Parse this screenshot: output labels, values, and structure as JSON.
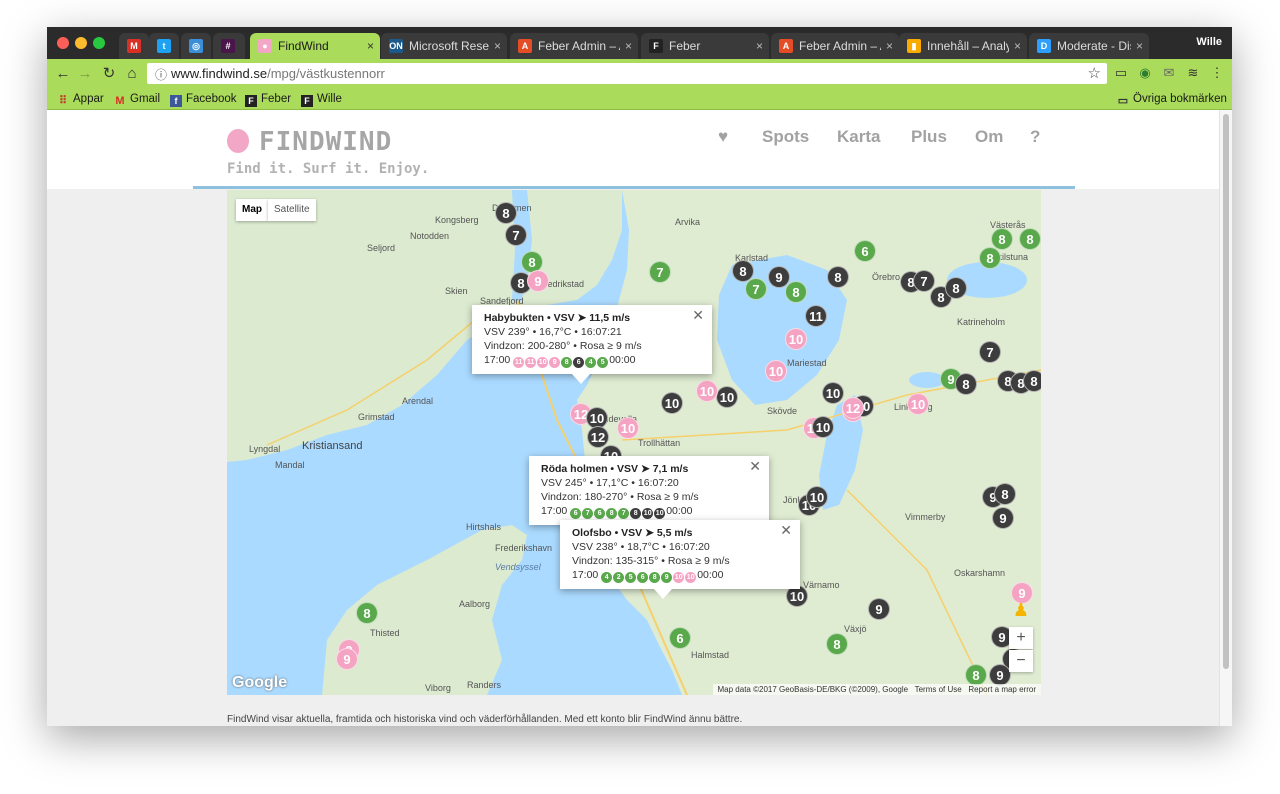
{
  "browser": {
    "profile": "Wille",
    "tabs": [
      {
        "title": "",
        "favicon": "M",
        "favicon_color": "#d93025",
        "name": "tab-gmail"
      },
      {
        "title": "",
        "favicon": "t",
        "favicon_color": "#1da1f2",
        "name": "tab-twitter"
      },
      {
        "title": "",
        "favicon": "◎",
        "favicon_color": "#3b8fd9",
        "name": "tab-rss"
      },
      {
        "title": "",
        "favicon": "#",
        "favicon_color": "#4a154b",
        "name": "tab-slack"
      },
      {
        "title": "FindWind",
        "favicon": "●",
        "favicon_color": "#f3a7c6",
        "name": "tab-findwind"
      },
      {
        "title": "Microsoft Research",
        "favicon": "ON",
        "favicon_color": "#1d5a8c",
        "name": "tab-microsoft-research"
      },
      {
        "title": "Feber Admin – Ar",
        "favicon": "A",
        "favicon_color": "#e44d26",
        "name": "tab-feber-admin-1"
      },
      {
        "title": "Feber",
        "favicon": "F",
        "favicon_color": "#222222",
        "name": "tab-feber"
      },
      {
        "title": "Feber Admin – Ar",
        "favicon": "A",
        "favicon_color": "#e44d26",
        "name": "tab-feber-admin-2"
      },
      {
        "title": "Innehåll – Analyti",
        "favicon": "▮",
        "favicon_color": "#f9ab00",
        "name": "tab-analytics"
      },
      {
        "title": "Moderate - Disqu",
        "favicon": "D",
        "favicon_color": "#2e9fff",
        "name": "tab-disqus"
      }
    ],
    "url_host": "www.findwind.se",
    "url_path": "/mpg/västkustennorr",
    "bookmarks": [
      {
        "label": "Appar",
        "icon": "apps-icon"
      },
      {
        "label": "Gmail",
        "icon": "gmail-icon"
      },
      {
        "label": "Facebook",
        "icon": "facebook-icon"
      },
      {
        "label": "Feber",
        "icon": "feber-icon"
      },
      {
        "label": "Wille",
        "icon": "feber-icon"
      }
    ],
    "other_bookmarks": "Övriga bokmärken"
  },
  "site": {
    "logo": "FINDWIND",
    "tagline": "Find it. Surf it. Enjoy.",
    "nav": {
      "heart": "♥",
      "spots": "Spots",
      "karta": "Karta",
      "plus": "Plus",
      "om": "Om",
      "help": "?"
    },
    "footer": "FindWind visar aktuella, framtida och historiska vind och väderförhållanden. Med ett konto blir FindWind ännu bättre."
  },
  "map": {
    "type_buttons": {
      "map": "Map",
      "satellite": "Satellite"
    },
    "google": "Google",
    "attribution": {
      "data": "Map data ©2017 GeoBasis-DE/BKG (©2009), Google",
      "terms": "Terms of Use",
      "report": "Report a map error"
    },
    "zoom_in": "+",
    "zoom_out": "−",
    "colors": {
      "strong": "#f4a4c2",
      "good": "#5aa84c",
      "weak": "#3d3d3d"
    },
    "labels": [
      {
        "text": "Drammen"
      },
      {
        "text": "Kongsberg"
      },
      {
        "text": "Notodden"
      },
      {
        "text": "Seljord"
      },
      {
        "text": "Skien"
      },
      {
        "text": "Sandefjord"
      },
      {
        "text": "Fredrikstad"
      },
      {
        "text": "Arvika"
      },
      {
        "text": "Karlstad"
      },
      {
        "text": "Örebro"
      },
      {
        "text": "Västerås"
      },
      {
        "text": "Eskilstuna"
      },
      {
        "text": "Katrineholm"
      },
      {
        "text": "Arendal"
      },
      {
        "text": "Grimstad"
      },
      {
        "text": "Kristiansand"
      },
      {
        "text": "Lyngdal"
      },
      {
        "text": "Mandal"
      },
      {
        "text": "Uddevalla"
      },
      {
        "text": "Trollhättan"
      },
      {
        "text": "Skövde"
      },
      {
        "text": "Linköping"
      },
      {
        "text": "Jönköping"
      },
      {
        "text": "Vimmerby"
      },
      {
        "text": "Hirtshals"
      },
      {
        "text": "Frederikshavn"
      },
      {
        "text": "Vendsyssel"
      },
      {
        "text": "Thisted"
      },
      {
        "text": "Aalborg"
      },
      {
        "text": "Viborg"
      },
      {
        "text": "Randers"
      },
      {
        "text": "Värnamo"
      },
      {
        "text": "Växjö"
      },
      {
        "text": "Oskarshamn"
      },
      {
        "text": "Halmstad"
      },
      {
        "text": "Mariestad"
      }
    ],
    "markers": [
      {
        "v": "8",
        "c": "weak"
      },
      {
        "v": "7",
        "c": "weak"
      },
      {
        "v": "8",
        "c": "good"
      },
      {
        "v": "8",
        "c": "weak"
      },
      {
        "v": "9",
        "c": "strong"
      },
      {
        "v": "7",
        "c": "good"
      },
      {
        "v": "8",
        "c": "weak"
      },
      {
        "v": "7",
        "c": "good"
      },
      {
        "v": "9",
        "c": "weak"
      },
      {
        "v": "8",
        "c": "good"
      },
      {
        "v": "8",
        "c": "weak"
      },
      {
        "v": "6",
        "c": "good"
      },
      {
        "v": "8",
        "c": "weak"
      },
      {
        "v": "7",
        "c": "weak"
      },
      {
        "v": "8",
        "c": "weak"
      },
      {
        "v": "8",
        "c": "weak"
      },
      {
        "v": "8",
        "c": "good"
      },
      {
        "v": "8",
        "c": "good"
      },
      {
        "v": "8",
        "c": "good"
      },
      {
        "v": "11",
        "c": "weak"
      },
      {
        "v": "10",
        "c": "strong"
      },
      {
        "v": "10",
        "c": "strong"
      },
      {
        "v": "7",
        "c": "weak"
      },
      {
        "v": "10",
        "c": "weak"
      },
      {
        "v": "10",
        "c": "weak"
      },
      {
        "v": "10",
        "c": "strong"
      },
      {
        "v": "10",
        "c": "weak"
      },
      {
        "v": "12",
        "c": "strong"
      },
      {
        "v": "10",
        "c": "weak"
      },
      {
        "v": "10",
        "c": "strong"
      },
      {
        "v": "12",
        "c": "weak"
      },
      {
        "v": "10",
        "c": "weak"
      },
      {
        "v": "10",
        "c": "strong"
      },
      {
        "v": "10",
        "c": "strong"
      },
      {
        "v": "10",
        "c": "weak"
      },
      {
        "v": "12",
        "c": "strong"
      },
      {
        "v": "10",
        "c": "weak"
      },
      {
        "v": "10",
        "c": "strong"
      },
      {
        "v": "9",
        "c": "good"
      },
      {
        "v": "8",
        "c": "weak"
      },
      {
        "v": "8",
        "c": "weak"
      },
      {
        "v": "8",
        "c": "weak"
      },
      {
        "v": "8",
        "c": "weak"
      },
      {
        "v": "10",
        "c": "weak"
      },
      {
        "v": "10",
        "c": "weak"
      },
      {
        "v": "9",
        "c": "weak"
      },
      {
        "v": "8",
        "c": "weak"
      },
      {
        "v": "9",
        "c": "weak"
      },
      {
        "v": "10",
        "c": "weak"
      },
      {
        "v": "9",
        "c": "weak"
      },
      {
        "v": "8",
        "c": "good"
      },
      {
        "v": "6",
        "c": "good"
      },
      {
        "v": "8",
        "c": "good"
      },
      {
        "v": "9",
        "c": "strong"
      },
      {
        "v": "9",
        "c": "strong"
      },
      {
        "v": "9",
        "c": "weak"
      },
      {
        "v": "8",
        "c": "weak"
      },
      {
        "v": "9",
        "c": "weak"
      },
      {
        "v": "9",
        "c": "strong"
      },
      {
        "v": "8",
        "c": "good"
      }
    ],
    "popups": [
      {
        "title": "Habybukten • VSV",
        "speed": "11,5 m/s",
        "line1": "VSV 239° • 16,7°C • 16:07:21",
        "line2": "Vindzon: 200-280° • Rosa ≥ 9 m/s",
        "from": "17:00",
        "to": "00:00",
        "forecast": [
          {
            "v": "11",
            "c": "strong"
          },
          {
            "v": "11",
            "c": "strong"
          },
          {
            "v": "10",
            "c": "strong"
          },
          {
            "v": "9",
            "c": "strong"
          },
          {
            "v": "8",
            "c": "good"
          },
          {
            "v": "6",
            "c": "weak"
          },
          {
            "v": "4",
            "c": "good"
          },
          {
            "v": "5",
            "c": "good"
          }
        ]
      },
      {
        "title": "Röda holmen • VSV",
        "speed": "7,1 m/s",
        "line1": "VSV 245° • 17,1°C • 16:07:20",
        "line2": "Vindzon: 180-270° • Rosa ≥ 9 m/s",
        "from": "17:00",
        "to": "00:00",
        "forecast": [
          {
            "v": "6",
            "c": "good"
          },
          {
            "v": "7",
            "c": "good"
          },
          {
            "v": "6",
            "c": "good"
          },
          {
            "v": "8",
            "c": "good"
          },
          {
            "v": "7",
            "c": "good"
          },
          {
            "v": "8",
            "c": "weak"
          },
          {
            "v": "10",
            "c": "weak"
          },
          {
            "v": "10",
            "c": "weak"
          }
        ]
      },
      {
        "title": "Olofsbo • VSV",
        "speed": "5,5 m/s",
        "line1": "VSV 238° • 18,7°C • 16:07:20",
        "line2": "Vindzon: 135-315° • Rosa ≥ 9 m/s",
        "from": "17:00",
        "to": "00:00",
        "forecast": [
          {
            "v": "4",
            "c": "good"
          },
          {
            "v": "2",
            "c": "good"
          },
          {
            "v": "5",
            "c": "good"
          },
          {
            "v": "6",
            "c": "good"
          },
          {
            "v": "8",
            "c": "good"
          },
          {
            "v": "9",
            "c": "good"
          },
          {
            "v": "10",
            "c": "strong"
          },
          {
            "v": "10",
            "c": "strong"
          }
        ]
      }
    ]
  }
}
